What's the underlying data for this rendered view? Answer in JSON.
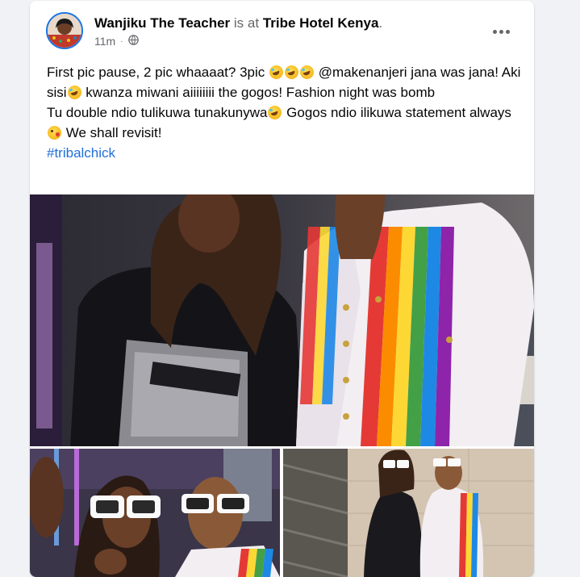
{
  "post": {
    "author": "Wanjiku The Teacher",
    "connector": "is at",
    "location": "Tribe Hotel Kenya",
    "location_suffix": ".",
    "time": "11m",
    "privacy_icon": "globe-icon",
    "more_icon": "more-options-icon",
    "text": {
      "l1a": "First pic pause, 2 pic whaaaat? 3pic ",
      "l1b": " @makenanjeri jana  was jana! Aki sisi",
      "l1c": " kwanza miwani aiiiiiiii the gogos! Fashion night was bomb",
      "l2a": "Tu double ndio tulikuwa tunakunywa",
      "l2b": " Gogos ndio ilikuwa statement always  ",
      "l2c": " We shall revisit!",
      "hashtag": "#tribalchick"
    },
    "emoji": {
      "rofl": "rolling-on-floor-laughing-emoji",
      "kiss": "face-blowing-kiss-emoji"
    },
    "photos": [
      "photo-main",
      "photo-bottom-left",
      "photo-bottom-right"
    ]
  },
  "colors": {
    "accent": "#1b74e4",
    "hashtag": "#216fdb",
    "muted": "#65676b",
    "background": "#f0f2f5"
  }
}
